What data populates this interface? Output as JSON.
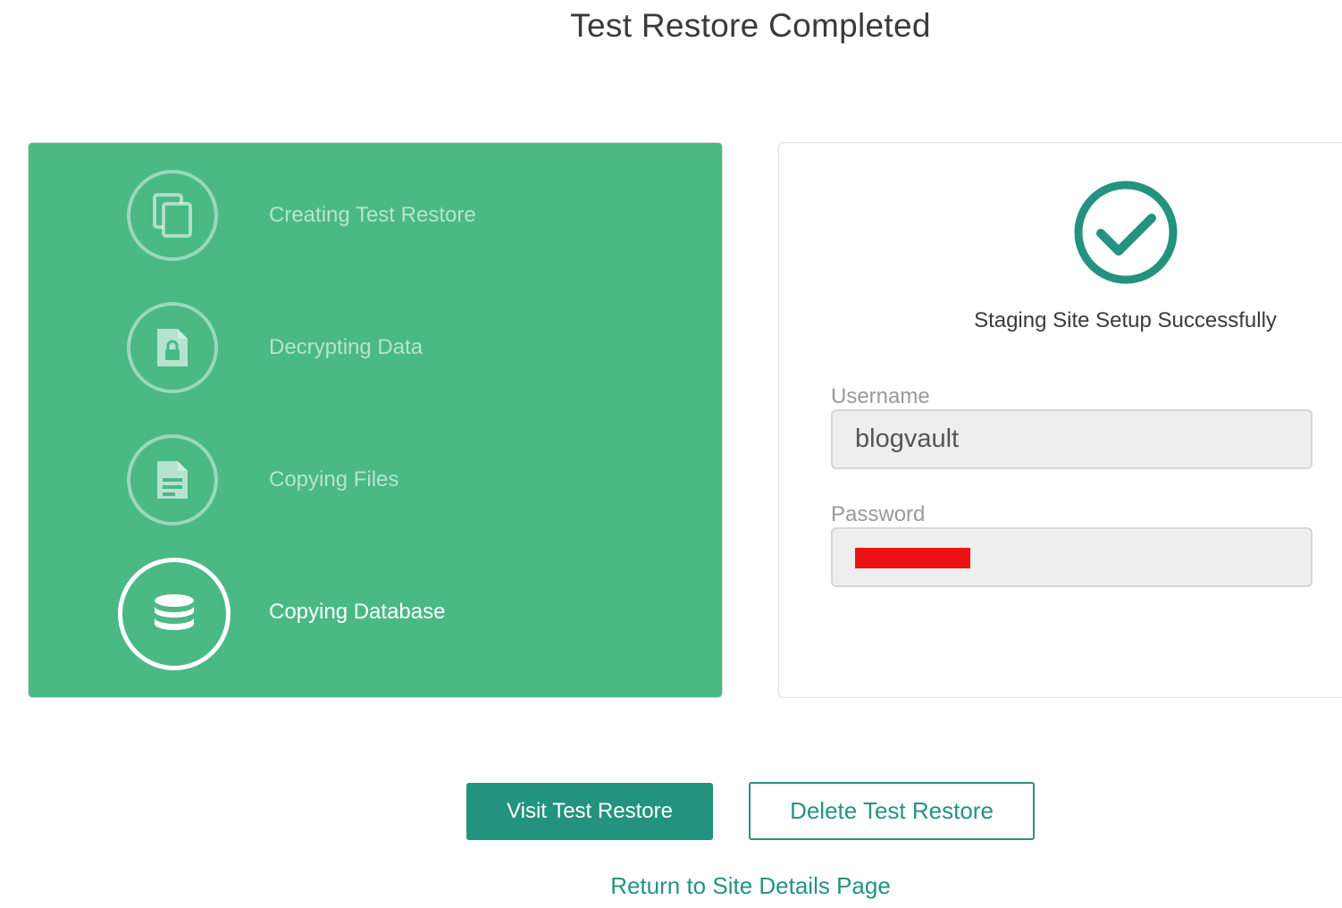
{
  "page_title": "Test Restore Completed",
  "steps": [
    {
      "label": "Creating Test Restore",
      "icon": "copy-icon",
      "state": "done"
    },
    {
      "label": "Decrypting Data",
      "icon": "locked-file-icon",
      "state": "done"
    },
    {
      "label": "Copying Files",
      "icon": "file-text-icon",
      "state": "done"
    },
    {
      "label": "Copying Database",
      "icon": "database-icon",
      "state": "active"
    }
  ],
  "result": {
    "status_icon": "check-circle-icon",
    "status_text": "Staging Site Setup Successfully",
    "username_label": "Username",
    "username_value": "blogvault",
    "password_label": "Password",
    "password_value": ""
  },
  "buttons": {
    "visit_label": "Visit Test Restore",
    "delete_label": "Delete Test Restore"
  },
  "links": {
    "return_label": "Return to Site Details Page"
  },
  "colors": {
    "panel_green": "#4ab984",
    "accent_teal": "#23937f",
    "redaction_red": "#ee1111"
  }
}
